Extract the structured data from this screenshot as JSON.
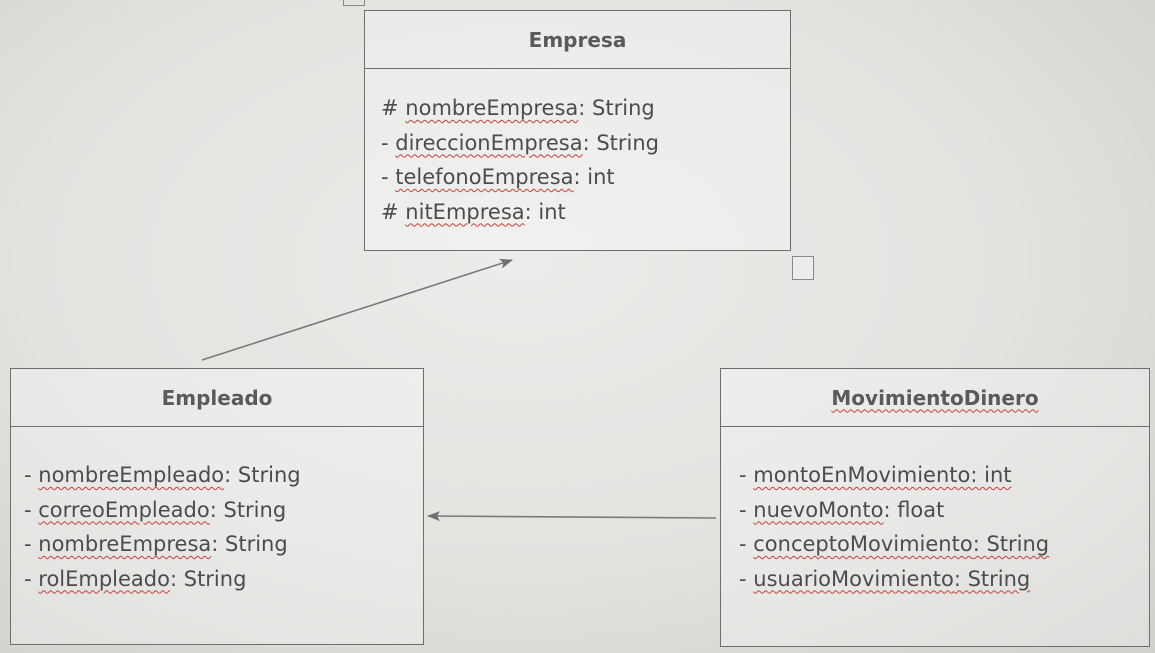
{
  "classes": {
    "empresa": {
      "name": "Empresa",
      "attributes": [
        {
          "visibility": "#",
          "name": "nombreEmpresa",
          "type": ": String"
        },
        {
          "visibility": "-",
          "name": "direccionEmpresa",
          "type": ": String"
        },
        {
          "visibility": "-",
          "name": "telefonoEmpresa",
          "type": ": int"
        },
        {
          "visibility": "#",
          "name": "nitEmpresa",
          "type": ": int"
        }
      ]
    },
    "empleado": {
      "name": "Empleado",
      "attributes": [
        {
          "visibility": "-",
          "name": "nombreEmpleado",
          "type": ": String"
        },
        {
          "visibility": "-",
          "name": "correoEmpleado",
          "type": ": String"
        },
        {
          "visibility": "-",
          "name": "nombreEmpresa",
          "type": ": String"
        },
        {
          "visibility": "-",
          "name": "rolEmpleado",
          "type": ": String"
        }
      ]
    },
    "movimiento": {
      "name": "MovimientoDinero",
      "attributes": [
        {
          "visibility": "-",
          "name": "montoEnMovimiento",
          "type": ": int"
        },
        {
          "visibility": "-",
          "name": "nuevoMonto",
          "type": ": float"
        },
        {
          "visibility": "-",
          "name": "conceptoMovimiento",
          "type": ": String"
        },
        {
          "visibility": "-",
          "name": "usuarioMovimiento",
          "type": ": String"
        }
      ]
    }
  },
  "relations": [
    {
      "from": "Empleado",
      "to": "Empresa",
      "style": "association-arrow"
    },
    {
      "from": "MovimientoDinero",
      "to": "Empleado",
      "style": "association-arrow"
    }
  ],
  "colors": {
    "line": "#6e6e6e",
    "text": "#4c4c4c",
    "spellcheck": "#c8413a"
  }
}
